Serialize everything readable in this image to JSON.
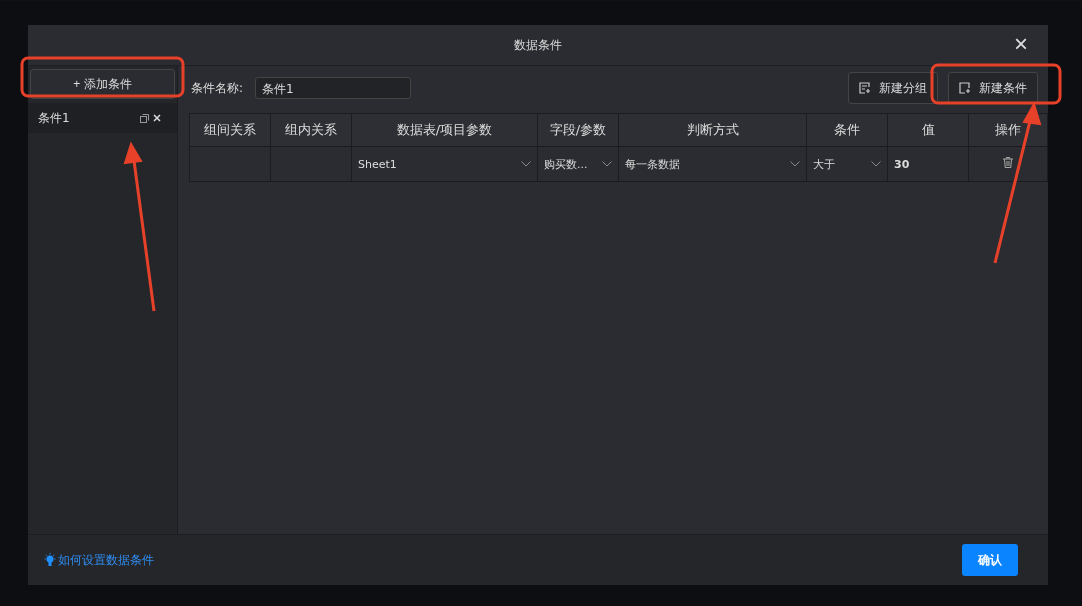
{
  "dialog": {
    "title": "数据条件",
    "close": "×"
  },
  "sidebar": {
    "add_button": "+ 添加条件",
    "items": [
      {
        "label": "条件1",
        "selected": true
      }
    ]
  },
  "name_field": {
    "label": "条件名称:",
    "value": "条件1"
  },
  "toolbar": {
    "buttons": [
      {
        "label": "新建分组",
        "kind": "group"
      },
      {
        "label": "新建条件",
        "kind": "condition"
      }
    ]
  },
  "table": {
    "columns": [
      "组间关系",
      "组内关系",
      "数据表/项目参数",
      "字段/参数",
      "判断方式",
      "条件",
      "值",
      "操作"
    ],
    "rows": [
      [
        {
          "kind": "empty"
        },
        {
          "kind": "empty"
        },
        {
          "kind": "select",
          "text": "Sheet1"
        },
        {
          "kind": "select",
          "text": "购买数..."
        },
        {
          "kind": "select",
          "text": "每一条数据"
        },
        {
          "kind": "select",
          "text": "大于"
        },
        {
          "kind": "value",
          "text": "30"
        },
        {
          "kind": "delete"
        }
      ]
    ]
  },
  "footer": {
    "help_link": "如何设置数据条件",
    "confirm": "确认"
  }
}
